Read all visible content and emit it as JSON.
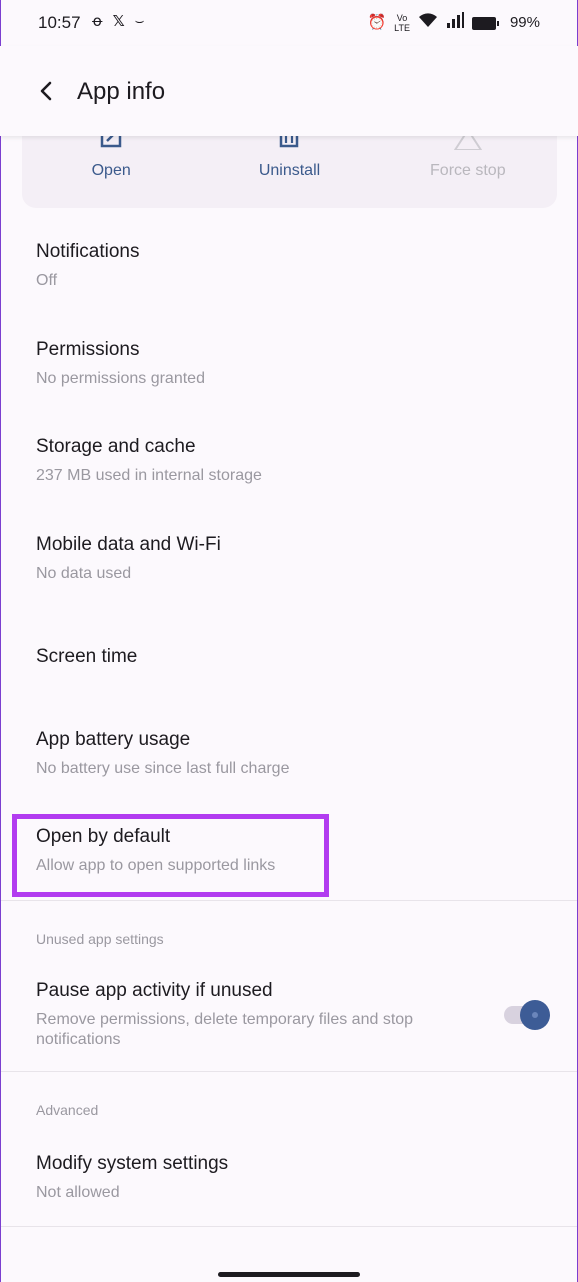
{
  "status_bar": {
    "time": "10:57",
    "battery_percent": "99%",
    "icons_left": [
      "n-icon",
      "x-icon",
      "amazon-icon"
    ],
    "icons_right": [
      "alarm-icon",
      "volte-icon",
      "wifi-icon",
      "signal-icon",
      "battery-icon"
    ]
  },
  "app_bar": {
    "title": "App info",
    "back_icon": "arrow-back-icon"
  },
  "actions": {
    "open": "Open",
    "uninstall": "Uninstall",
    "force_stop": "Force stop"
  },
  "items": {
    "notifications": {
      "title": "Notifications",
      "sub": "Off"
    },
    "permissions": {
      "title": "Permissions",
      "sub": "No permissions granted"
    },
    "storage": {
      "title": "Storage and cache",
      "sub": "237 MB used in internal storage"
    },
    "mobile_data": {
      "title": "Mobile data and Wi-Fi",
      "sub": "No data used"
    },
    "screen_time": {
      "title": "Screen time"
    },
    "battery": {
      "title": "App battery usage",
      "sub": "No battery use since last full charge"
    },
    "open_by_default": {
      "title": "Open by default",
      "sub": "Allow app to open supported links"
    },
    "pause_activity": {
      "title": "Pause app activity if unused",
      "sub": "Remove permissions, delete temporary files and stop notifications",
      "enabled": true
    },
    "modify_system": {
      "title": "Modify system settings",
      "sub": "Not allowed"
    }
  },
  "sections": {
    "unused": "Unused app settings",
    "advanced": "Advanced"
  },
  "colors": {
    "accent": "#3d5c96",
    "highlight": "#b23cf0",
    "background": "#fcf9fd"
  }
}
